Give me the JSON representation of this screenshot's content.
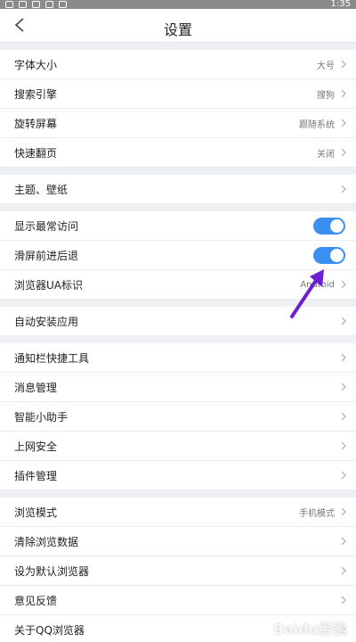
{
  "status_bar": {
    "time": "1:35"
  },
  "header": {
    "title": "设置"
  },
  "groups": [
    [
      {
        "label": "字体大小",
        "value": "大号"
      },
      {
        "label": "搜索引擎",
        "value": "搜狗"
      },
      {
        "label": "旋转屏幕",
        "value": "跟随系统"
      },
      {
        "label": "快速翻页",
        "value": "关闭"
      }
    ],
    [
      {
        "label": "主题、壁纸",
        "value": ""
      }
    ],
    [
      {
        "label": "显示最常访问",
        "toggle": true
      },
      {
        "label": "滑屏前进后退",
        "toggle": true
      },
      {
        "label": "浏览器UA标识",
        "value": "Android"
      }
    ],
    [
      {
        "label": "自动安装应用",
        "value": ""
      }
    ],
    [
      {
        "label": "通知栏快捷工具",
        "value": ""
      },
      {
        "label": "消息管理",
        "value": ""
      },
      {
        "label": "智能小助手",
        "value": ""
      },
      {
        "label": "上网安全",
        "value": ""
      },
      {
        "label": "插件管理",
        "value": ""
      }
    ],
    [
      {
        "label": "浏览模式",
        "value": "手机模式"
      },
      {
        "label": "清除浏览数据",
        "value": ""
      },
      {
        "label": "设为默认浏览器",
        "value": ""
      },
      {
        "label": "意见反馈",
        "value": ""
      },
      {
        "label": "关于QQ浏览器",
        "value": ""
      }
    ]
  ],
  "colors": {
    "accent": "#3b8ff0",
    "annotation_arrow": "#6a1fd1"
  },
  "watermark": "Baidu经验"
}
